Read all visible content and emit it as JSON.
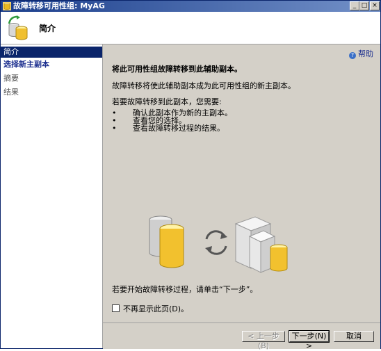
{
  "window": {
    "title": "故障转移可用性组: MyAG",
    "controls": [
      "_",
      "□",
      "×"
    ]
  },
  "header": {
    "title": "简介"
  },
  "nav": {
    "items": [
      {
        "label": "简介",
        "state": "selected"
      },
      {
        "label": "选择新主副本",
        "state": "link"
      },
      {
        "label": "摘要",
        "state": "disabled"
      },
      {
        "label": "结果",
        "state": "disabled"
      }
    ]
  },
  "content": {
    "help_label": "帮助",
    "heading": "将此可用性组故障转移到此辅助副本。",
    "description": "故障转移将使此辅助副本成为此可用性组的新主副本。",
    "requirements_intro": "若要故障转移到此副本，您需要:",
    "bullets": [
      "确认此副本作为新的主副本。",
      "查看您的选择。",
      "查看故障转移过程的结果。"
    ],
    "instruction": "若要开始故障转移过程，请单击“下一步”。",
    "checkbox_label": "不再显示此页(D)。"
  },
  "footer": {
    "back_label": "< 上一步(B)",
    "next_label": "下一步(N) >",
    "cancel_label": "取消"
  }
}
